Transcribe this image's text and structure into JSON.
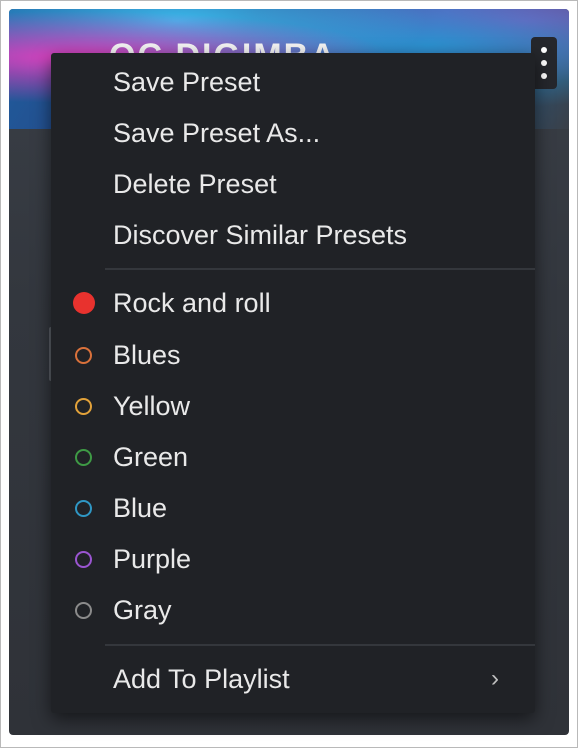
{
  "preset": {
    "title": "OC DIGIMBA"
  },
  "menu": {
    "actions": [
      {
        "label": "Save Preset"
      },
      {
        "label": "Save Preset As..."
      },
      {
        "label": "Delete Preset"
      },
      {
        "label": "Discover Similar Presets"
      }
    ],
    "tags": [
      {
        "label": "Rock and roll",
        "color": "#e8322e",
        "style": "filled"
      },
      {
        "label": "Blues",
        "color": "#d9713b",
        "style": "ring"
      },
      {
        "label": "Yellow",
        "color": "#e2a23a",
        "style": "ring"
      },
      {
        "label": "Green",
        "color": "#3e9a45",
        "style": "ring"
      },
      {
        "label": "Blue",
        "color": "#2f97c4",
        "style": "ring"
      },
      {
        "label": "Purple",
        "color": "#9a55d0",
        "style": "ring"
      },
      {
        "label": "Gray",
        "color": "#8b8b8b",
        "style": "ring"
      }
    ],
    "playlist": {
      "label": "Add To Playlist",
      "chevron": "›"
    }
  },
  "icons": {
    "kebab": "more-vertical-icon",
    "submenu": "chevron-right-icon"
  }
}
